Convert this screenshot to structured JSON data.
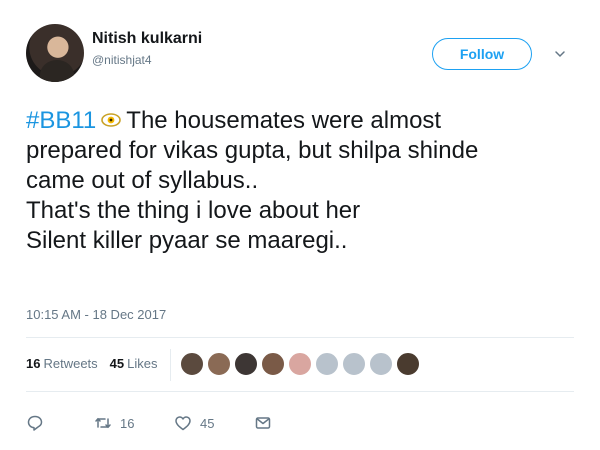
{
  "user": {
    "display_name": "Nitish kulkarni",
    "handle": "@nitishjat4"
  },
  "header": {
    "follow_label": "Follow"
  },
  "tweet": {
    "hashtag": "#BB11",
    "lines": [
      "The housemates were almost",
      "prepared for vikas gupta, but shilpa shinde",
      "came out of syllabus..",
      "That's the thing i love about her",
      "Silent killer pyaar se maaregi.."
    ],
    "timestamp": "10:15 AM - 18 Dec 2017"
  },
  "stats": {
    "retweets_count": "16",
    "retweets_label": "Retweets",
    "likes_count": "45",
    "likes_label": "Likes"
  },
  "likers": [
    {
      "color": "#5b4a3e"
    },
    {
      "color": "#8a6a55"
    },
    {
      "color": "#3d3634"
    },
    {
      "color": "#7a5a47"
    },
    {
      "color": "#d9a6a0"
    },
    {
      "color": "#b8c2cc"
    },
    {
      "color": "#b8c2cc"
    },
    {
      "color": "#b8c2cc"
    },
    {
      "color": "#4a3b2f"
    }
  ],
  "actions": {
    "retweet_count": "16",
    "like_count": "45"
  },
  "colors": {
    "accent": "#1da1f2",
    "hashtag": "#1b95e0",
    "muted": "#657786"
  },
  "icons": [
    "avatar",
    "follow-caret-icon",
    "eye-emoji-icon",
    "reply-icon",
    "retweet-icon",
    "like-icon",
    "message-icon"
  ]
}
